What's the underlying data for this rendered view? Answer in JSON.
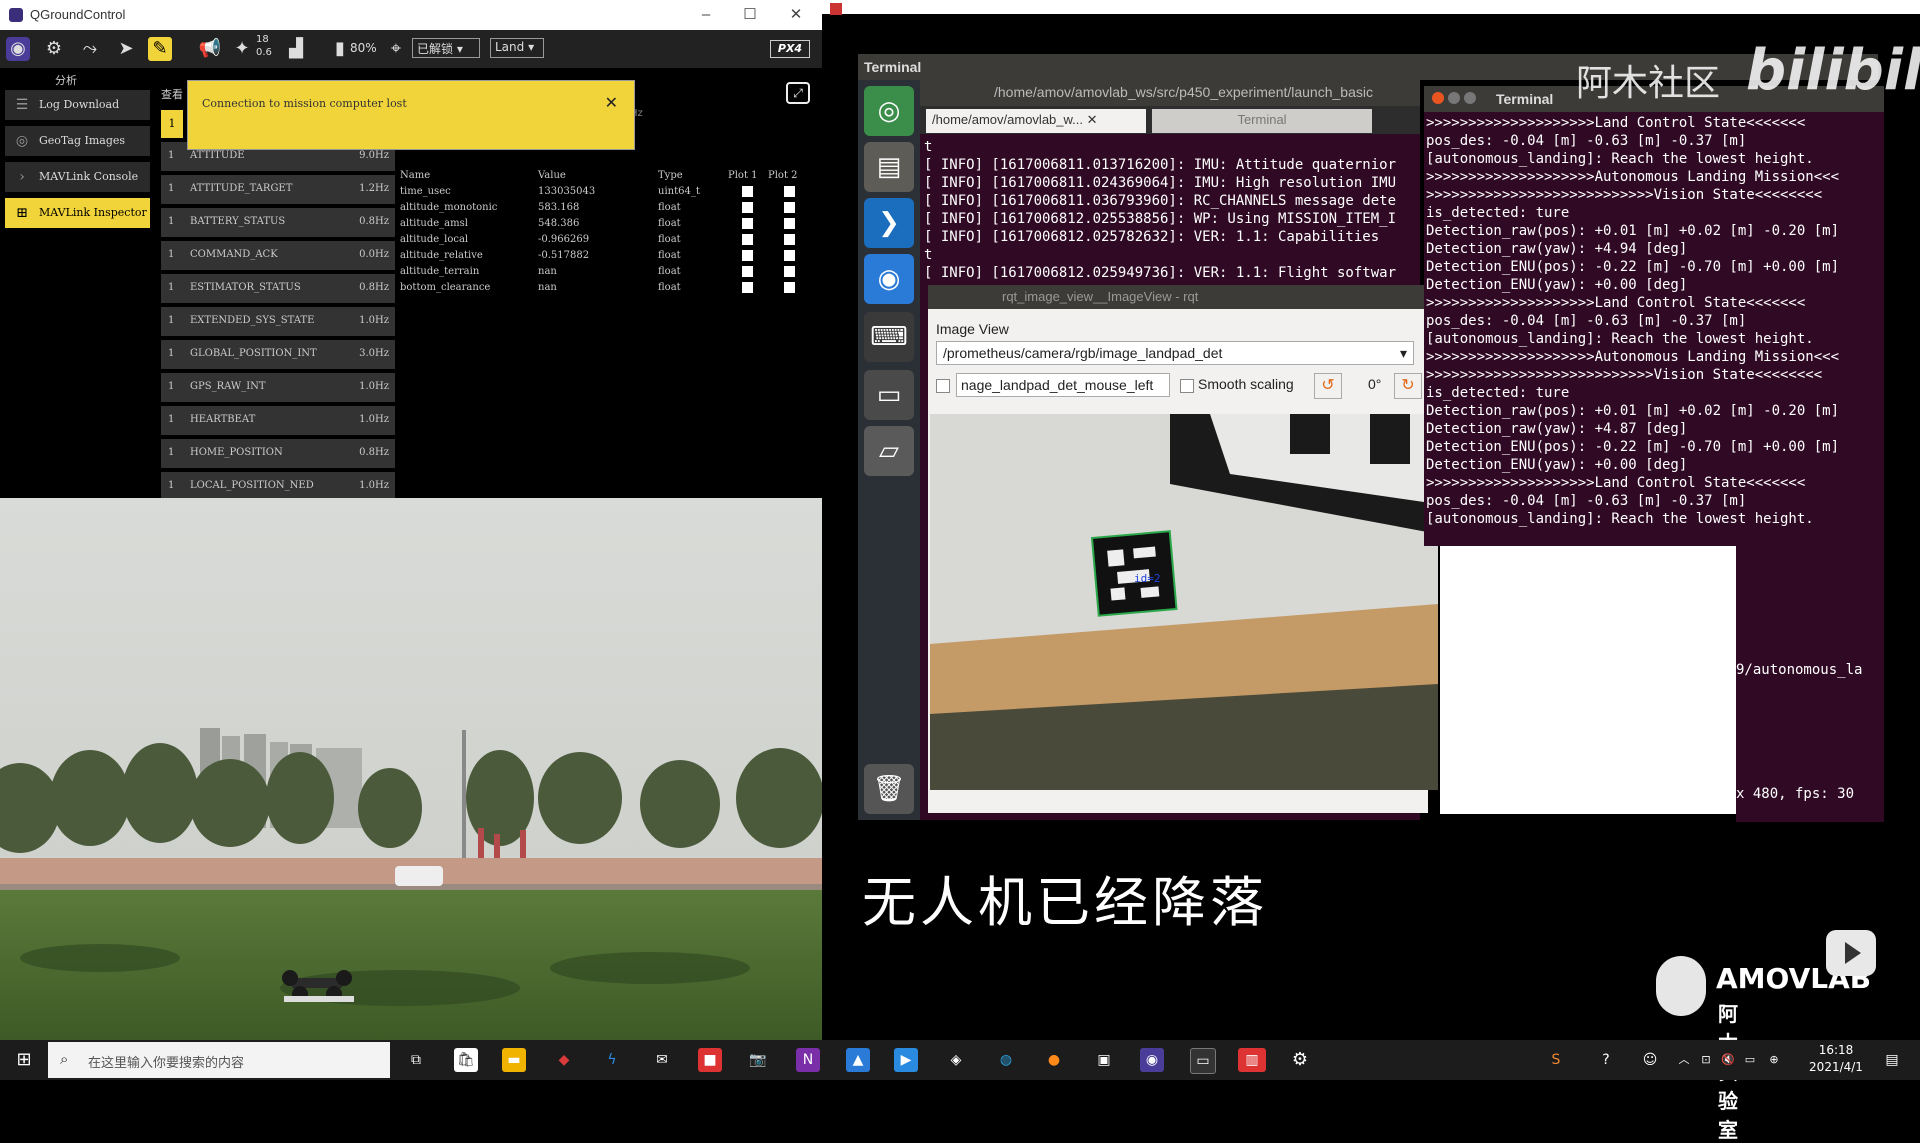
{
  "qgc": {
    "window_title": "QGroundControl",
    "toolbar": {
      "sat_count": "18",
      "hdop": "0.6",
      "battery": "80%",
      "arm_state": "已解锁",
      "flight_mode": "Land",
      "brand": "PX4"
    },
    "sidebar_header": "分析",
    "sidebar": [
      {
        "label": "Log Download",
        "icon": "log-icon"
      },
      {
        "label": "GeoTag Images",
        "icon": "geotag-icon"
      },
      {
        "label": "MAVLink Console",
        "icon": "console-icon"
      },
      {
        "label": "MAVLink Inspector",
        "icon": "inspector-icon",
        "active": true
      }
    ],
    "view_label": "查看",
    "top_row_number": "1",
    "header_hz_fragment": "Hz",
    "warning": "Connection to mission computer lost",
    "messages": [
      {
        "n": "1",
        "name": "ATTITUDE",
        "hz": "9.0Hz"
      },
      {
        "n": "1",
        "name": "ATTITUDE_TARGET",
        "hz": "1.2Hz"
      },
      {
        "n": "1",
        "name": "BATTERY_STATUS",
        "hz": "0.8Hz"
      },
      {
        "n": "1",
        "name": "COMMAND_ACK",
        "hz": "0.0Hz"
      },
      {
        "n": "1",
        "name": "ESTIMATOR_STATUS",
        "hz": "0.8Hz"
      },
      {
        "n": "1",
        "name": "EXTENDED_SYS_STATE",
        "hz": "1.0Hz"
      },
      {
        "n": "1",
        "name": "GLOBAL_POSITION_INT",
        "hz": "3.0Hz"
      },
      {
        "n": "1",
        "name": "GPS_RAW_INT",
        "hz": "1.0Hz"
      },
      {
        "n": "1",
        "name": "HEARTBEAT",
        "hz": "1.0Hz"
      },
      {
        "n": "1",
        "name": "HOME_POSITION",
        "hz": "0.8Hz"
      },
      {
        "n": "1",
        "name": "LOCAL_POSITION_NED",
        "hz": "1.0Hz"
      }
    ],
    "field_headers": {
      "name": "Name",
      "value": "Value",
      "type": "Type",
      "plot1": "Plot 1",
      "plot2": "Plot 2"
    },
    "fields": [
      {
        "name": "time_usec",
        "value": "133035043",
        "type": "uint64_t"
      },
      {
        "name": "altitude_monotonic",
        "value": "583.168",
        "type": "float"
      },
      {
        "name": "altitude_amsl",
        "value": "548.386",
        "type": "float"
      },
      {
        "name": "altitude_local",
        "value": "-0.966269",
        "type": "float"
      },
      {
        "name": "altitude_relative",
        "value": "-0.517882",
        "type": "float"
      },
      {
        "name": "altitude_terrain",
        "value": "nan",
        "type": "float"
      },
      {
        "name": "bottom_clearance",
        "value": "nan",
        "type": "float"
      }
    ]
  },
  "terminal_app_title": "Terminal",
  "term1": {
    "path": "/home/amov/amovlab_ws/src/p450_experiment/launch_basic",
    "tab1": "/home/amov/amovlab_w...",
    "tab2": "Terminal",
    "lines": [
      "t",
      "[ INFO] [1617006811.013716200]: IMU: Attitude quaternior",
      "[ INFO] [1617006811.024369064]: IMU: High resolution IMU",
      "[ INFO] [1617006811.036793960]: RC_CHANNELS message dete",
      "[ INFO] [1617006812.025538856]: WP: Using MISSION_ITEM_I",
      "[ INFO] [1617006812.025782632]: VER: 1.1: Capabilities",
      "t",
      "[ INFO] [1617006812.025949736]: VER: 1.1: Flight softwar"
    ]
  },
  "rqt": {
    "title": "rqt_image_view__ImageView - rqt",
    "panel": "Image View",
    "topic": "/prometheus/camera/rgb/image_landpad_det",
    "mouse_topic": "nage_landpad_det_mouse_left",
    "smooth": "Smooth scaling",
    "rotation": "0°",
    "marker_id": "id=2"
  },
  "term2": {
    "title": "Terminal",
    "lines": [
      ">>>>>>>>>>>>>>>>>>>>Land Control State<<<<<<<",
      "pos_des: -0.04 [m] -0.63 [m] -0.37 [m]",
      "[autonomous_landing]: Reach the lowest height.",
      ">>>>>>>>>>>>>>>>>>>>Autonomous Landing Mission<<<",
      ">>>>>>>>>>>>>>>>>>>>>>>>>>>Vision State<<<<<<<<",
      "is_detected: ture",
      "Detection_raw(pos): +0.01 [m] +0.02 [m] -0.20 [m]",
      "Detection_raw(yaw): +4.94 [deg]",
      "Detection_ENU(pos): -0.22 [m] -0.70 [m] +0.00 [m]",
      "Detection_ENU(yaw): +0.00 [deg]",
      ">>>>>>>>>>>>>>>>>>>>Land Control State<<<<<<<",
      "pos_des: -0.04 [m] -0.63 [m] -0.37 [m]",
      "[autonomous_landing]: Reach the lowest height.",
      ">>>>>>>>>>>>>>>>>>>>Autonomous Landing Mission<<<",
      ">>>>>>>>>>>>>>>>>>>>>>>>>>>Vision State<<<<<<<<",
      "is_detected: ture",
      "Detection_raw(pos): +0.01 [m] +0.02 [m] -0.20 [m]",
      "Detection_raw(yaw): +4.87 [deg]",
      "Detection_ENU(pos): -0.22 [m] -0.70 [m] +0.00 [m]",
      "Detection_ENU(yaw): +0.00 [deg]",
      ">>>>>>>>>>>>>>>>>>>>Land Control State<<<<<<<",
      "pos_des: -0.04 [m] -0.63 [m] -0.37 [m]",
      "[autonomous_landing]: Reach the lowest height."
    ],
    "trail_path": "9/autonomous_la",
    "trail_fps": "x 480, fps: 30"
  },
  "caption": "无人机已经降落",
  "watermark_cn": "阿木社区",
  "watermark_bili": "bilibili",
  "amov": {
    "en": "AMOVLAB",
    "cn": "阿木实验室"
  },
  "taskbar": {
    "search_placeholder": "在这里输入你要搜索的内容",
    "time": "16:18",
    "date": "2021/4/1"
  }
}
